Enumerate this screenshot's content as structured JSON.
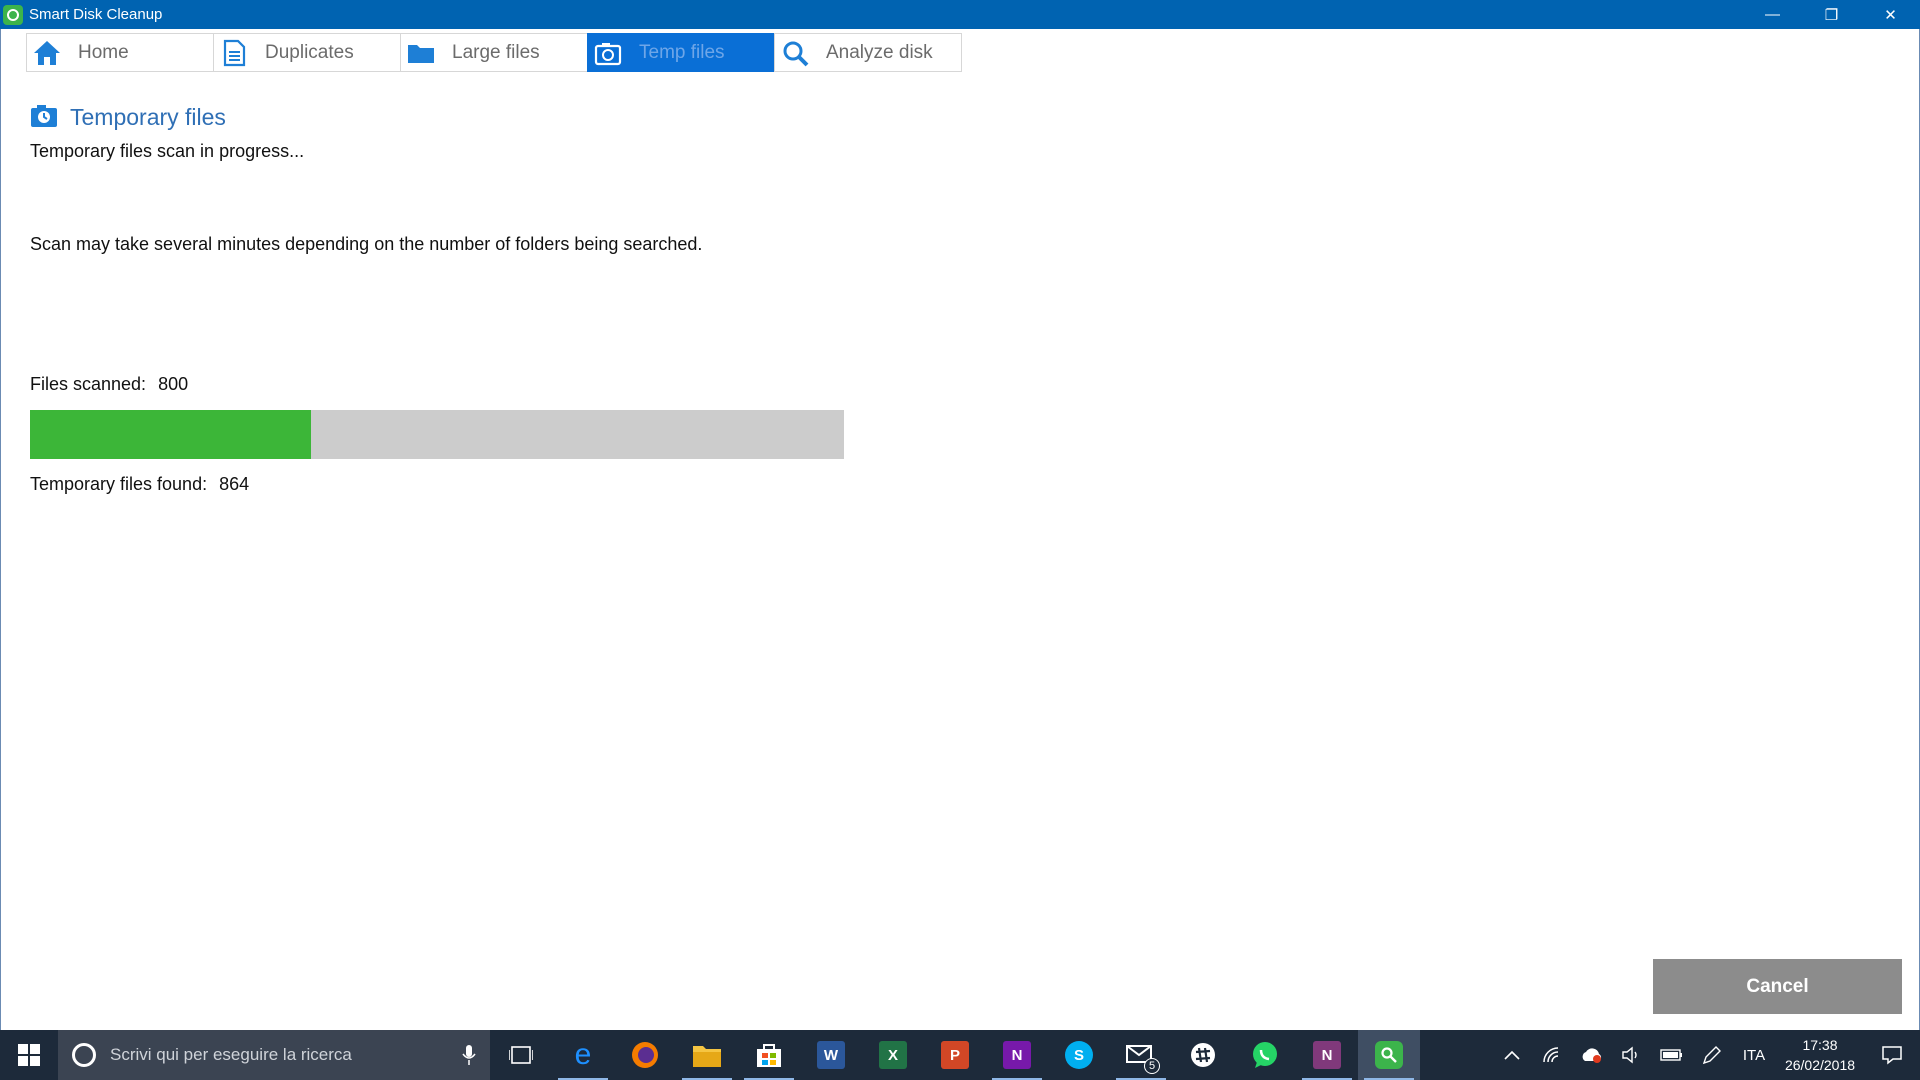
{
  "window": {
    "title": "Smart Disk Cleanup",
    "controls": {
      "minimize": "—",
      "restore": "❐",
      "close": "✕"
    }
  },
  "tabs": [
    {
      "label": "Home",
      "icon": "home-icon",
      "active": false
    },
    {
      "label": "Duplicates",
      "icon": "document-icon",
      "active": false
    },
    {
      "label": "Large files",
      "icon": "folder-icon",
      "active": false
    },
    {
      "label": "Temp files",
      "icon": "camera-clock-icon",
      "active": true
    },
    {
      "label": "Analyze disk",
      "icon": "magnifier-icon",
      "active": false
    }
  ],
  "main": {
    "section_title": "Temporary files",
    "status": "Temporary files scan in progress...",
    "info": "Scan may take several minutes depending on the number of folders being searched.",
    "files_scanned_label": "Files scanned:",
    "files_scanned_value": "800",
    "progress_fraction": 0.345,
    "found_label": "Temporary files found:",
    "found_value": "864",
    "cancel_label": "Cancel"
  },
  "colors": {
    "titlebar": "#0063b1",
    "tab_active": "#0a6fd6",
    "section_title": "#2f6fb5",
    "progress_fill": "#3cb638",
    "progress_track": "#cccccc",
    "cancel_button": "#8c8c8c"
  },
  "taskbar": {
    "search_placeholder": "Scrivi qui per eseguire la ricerca",
    "apps": [
      {
        "name": "task-view-icon"
      },
      {
        "name": "edge-icon",
        "letter": "e"
      },
      {
        "name": "firefox-icon"
      },
      {
        "name": "file-explorer-icon"
      },
      {
        "name": "store-icon"
      },
      {
        "name": "word-icon",
        "letter": "W"
      },
      {
        "name": "excel-icon",
        "letter": "X"
      },
      {
        "name": "powerpoint-icon",
        "letter": "P"
      },
      {
        "name": "onenote-icon",
        "letter": "N"
      },
      {
        "name": "skype-icon",
        "letter": "S"
      },
      {
        "name": "mail-icon",
        "badge": "5"
      },
      {
        "name": "slack-icon"
      },
      {
        "name": "whatsapp-icon"
      },
      {
        "name": "onenote-2016-icon",
        "letter": "N"
      },
      {
        "name": "smart-disk-cleanup-icon"
      }
    ],
    "language": "ITA",
    "time": "17:38",
    "date": "26/02/2018"
  }
}
